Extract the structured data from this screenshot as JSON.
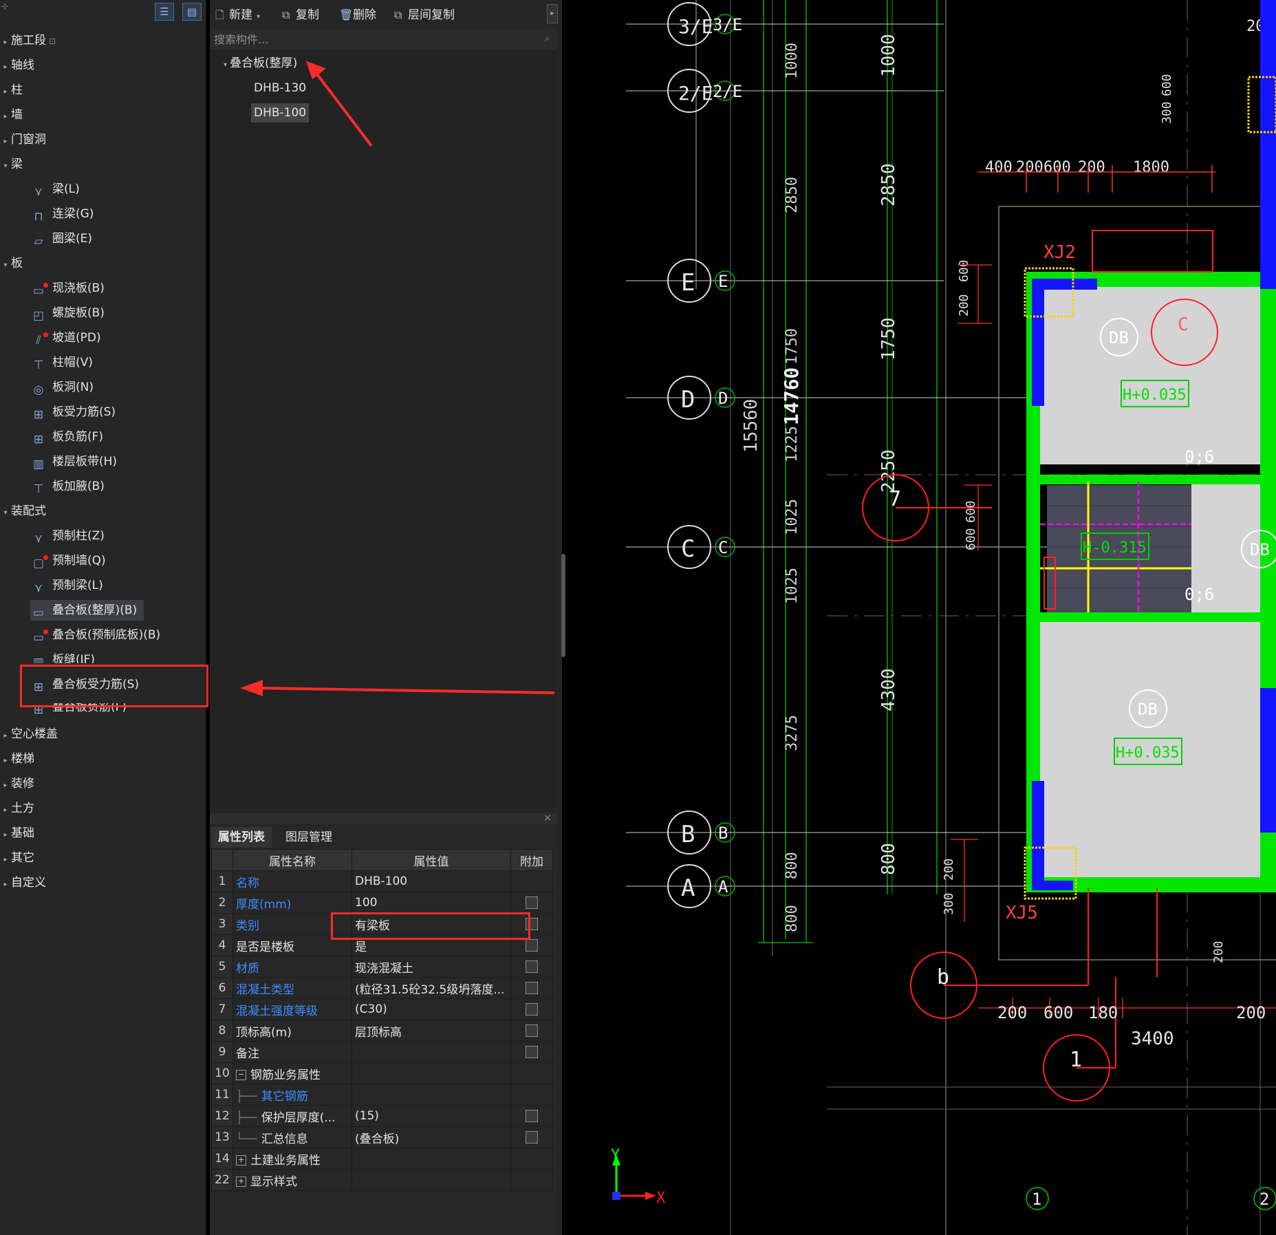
{
  "tree": {
    "items": [
      {
        "label": "施工段",
        "lock": "🔒"
      },
      {
        "label": "轴线"
      },
      {
        "label": "柱"
      },
      {
        "label": "墙"
      },
      {
        "label": "门窗洞"
      },
      {
        "label": "梁"
      },
      {
        "label": "板"
      },
      {
        "label": "装配式"
      },
      {
        "label": "空心楼盖"
      },
      {
        "label": "楼梯"
      },
      {
        "label": "装修"
      },
      {
        "label": "土方"
      },
      {
        "label": "基础"
      },
      {
        "label": "其它"
      },
      {
        "label": "自定义"
      }
    ],
    "beam_children": [
      {
        "label": "梁(L)"
      },
      {
        "label": "连梁(G)"
      },
      {
        "label": "圈梁(E)"
      }
    ],
    "slab_children": [
      {
        "label": "现浇板(B)"
      },
      {
        "label": "螺旋板(B)"
      },
      {
        "label": "坡道(PD)"
      },
      {
        "label": "柱帽(V)"
      },
      {
        "label": "板洞(N)"
      },
      {
        "label": "板受力筋(S)"
      },
      {
        "label": "板负筋(F)"
      },
      {
        "label": "楼层板带(H)"
      },
      {
        "label": "板加腋(B)"
      }
    ],
    "prefab_children": [
      {
        "label": "预制柱(Z)"
      },
      {
        "label": "预制墙(Q)"
      },
      {
        "label": "预制梁(L)"
      },
      {
        "label": "叠合板(整厚)(B)"
      },
      {
        "label": "叠合板(预制底板)(B)"
      },
      {
        "label": "板缝(JF)"
      },
      {
        "label": "叠合板受力筋(S)"
      },
      {
        "label": "叠合板负筋(F)"
      }
    ]
  },
  "toolbar": {
    "new_label": "新建",
    "copy_label": "复制",
    "delete_label": "删除",
    "floor_copy_label": "层间复制"
  },
  "search": {
    "placeholder": "搜索构件..."
  },
  "component_list": {
    "group": "叠合板(整厚)",
    "items": [
      "DHB-130",
      "DHB-100"
    ]
  },
  "properties": {
    "tabs": [
      "属性列表",
      "图层管理"
    ],
    "headers": [
      "属性名称",
      "属性值",
      "附加"
    ],
    "rows": [
      {
        "num": "1",
        "name": "名称",
        "value": "DHB-100"
      },
      {
        "num": "2",
        "name": "厚度(mm)",
        "value": "100"
      },
      {
        "num": "3",
        "name": "类别",
        "value": "有梁板"
      },
      {
        "num": "4",
        "name": "是否是楼板",
        "value": "是"
      },
      {
        "num": "5",
        "name": "材质",
        "value": "现浇混凝土"
      },
      {
        "num": "6",
        "name": "混凝土类型",
        "value": "(粒径31.5砼32.5级坍落度..."
      },
      {
        "num": "7",
        "name": "混凝土强度等级",
        "value": "(C30)"
      },
      {
        "num": "8",
        "name": "顶标高(m)",
        "value": "层顶标高"
      },
      {
        "num": "9",
        "name": "备注",
        "value": ""
      },
      {
        "num": "10",
        "name": "钢筋业务属性",
        "value": ""
      },
      {
        "num": "11",
        "name": "其它钢筋",
        "value": ""
      },
      {
        "num": "12",
        "name": "保护层厚度(...",
        "value": "(15)"
      },
      {
        "num": "13",
        "name": "汇总信息",
        "value": "(叠合板)"
      },
      {
        "num": "14",
        "name": "土建业务属性",
        "value": ""
      },
      {
        "num": "22",
        "name": "显示样式",
        "value": ""
      }
    ]
  },
  "cad": {
    "axis_labels": [
      "3/E",
      "2/E",
      "E",
      "D",
      "C",
      "B",
      "A"
    ],
    "bubble_texts": [
      "3/E",
      "2/E",
      "E",
      "D",
      "C",
      "B",
      "A",
      "1",
      "2"
    ],
    "dims_inner": [
      "1000",
      "2850",
      "1750",
      "2250",
      "4300",
      "800"
    ],
    "dims_outer": [
      "1000",
      "2850",
      "1750",
      "1225",
      "1025",
      "1025",
      "3275",
      "800",
      "800"
    ],
    "total_dims": [
      "15560",
      "14760"
    ],
    "top_dims": [
      "400",
      "200",
      "600",
      "200",
      "1800"
    ],
    "bottom_dims": [
      "200",
      "600",
      "180",
      "200"
    ],
    "bottom_span": "3400",
    "side_dims": [
      "200",
      "600",
      "200",
      "600",
      "300",
      "600",
      "600",
      "200",
      "300",
      "200",
      "600",
      "200"
    ],
    "slab_marks": [
      "DB",
      "DB",
      "DB"
    ],
    "elevations": [
      "H+0.035",
      "H-0.315",
      "H+0.035"
    ],
    "labels": [
      "XJ2",
      "XJ5",
      "0;6",
      "0;6",
      "C",
      "b",
      "1",
      "7"
    ],
    "axis_x": "X",
    "axis_y": "Y"
  },
  "colors": {
    "accent": "#3c8cff",
    "highlight": "#ff2a2a",
    "cad_green": "#00ff00",
    "cad_blue": "#0000ff"
  }
}
